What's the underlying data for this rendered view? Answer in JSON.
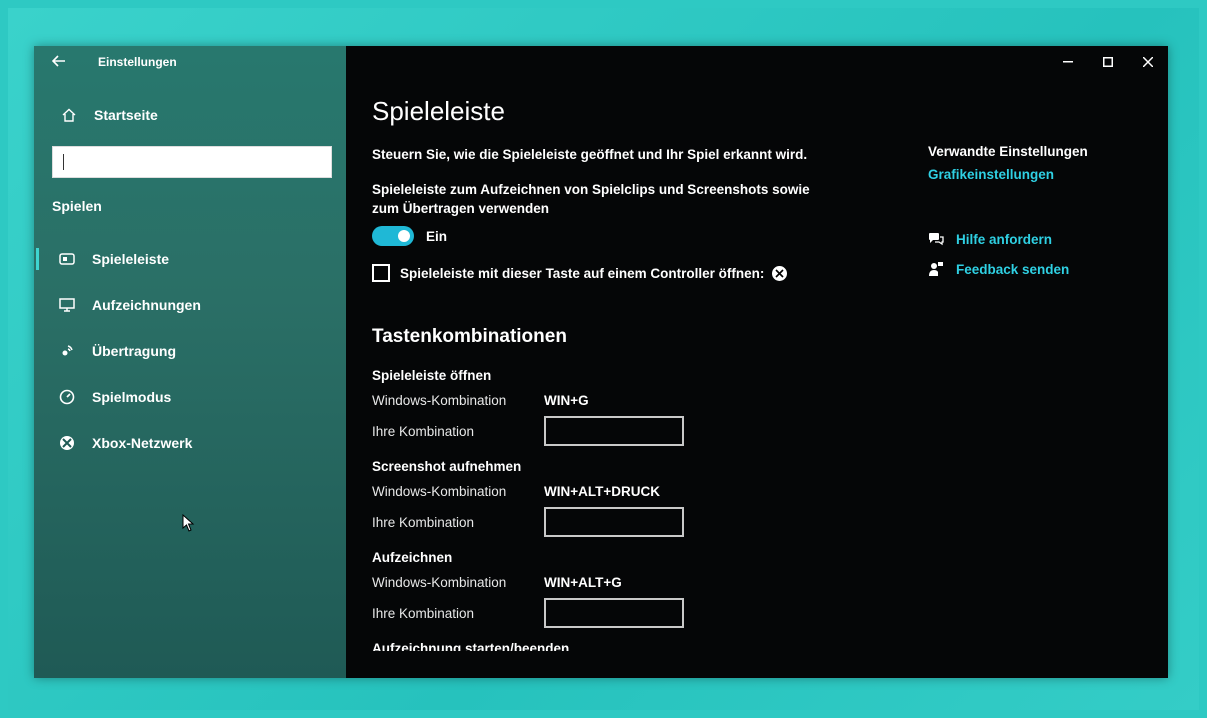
{
  "window": {
    "app_title": "Einstellungen"
  },
  "sidebar": {
    "home_label": "Startseite",
    "search_placeholder": "",
    "section_label": "Spielen",
    "items": [
      {
        "label": "Spieleleiste",
        "icon": "gamebar-icon",
        "active": true
      },
      {
        "label": "Aufzeichnungen",
        "icon": "captures-icon",
        "active": false
      },
      {
        "label": "Übertragung",
        "icon": "broadcast-icon",
        "active": false
      },
      {
        "label": "Spielmodus",
        "icon": "gamemode-icon",
        "active": false
      },
      {
        "label": "Xbox-Netzwerk",
        "icon": "xbox-icon",
        "active": false
      }
    ]
  },
  "main": {
    "title": "Spieleleiste",
    "description": "Steuern Sie, wie die Spieleleiste geöffnet und Ihr Spiel erkannt wird.",
    "toggle": {
      "label": "Spieleleiste zum Aufzeichnen von Spielclips und Screenshots sowie zum Übertragen verwenden",
      "state": "Ein",
      "on": true
    },
    "controller_checkbox": {
      "label": "Spieleleiste mit dieser Taste auf einem Controller öffnen:",
      "checked": false
    },
    "shortcuts_title": "Tastenkombinationen",
    "shortcuts": [
      {
        "heading": "Spieleleiste öffnen",
        "windows_label": "Windows-Kombination",
        "windows_value": "WIN+G",
        "custom_label": "Ihre Kombination",
        "custom_value": ""
      },
      {
        "heading": "Screenshot aufnehmen",
        "windows_label": "Windows-Kombination",
        "windows_value": "WIN+ALT+DRUCK",
        "custom_label": "Ihre Kombination",
        "custom_value": ""
      },
      {
        "heading": "Aufzeichnen",
        "windows_label": "Windows-Kombination",
        "windows_value": "WIN+ALT+G",
        "custom_label": "Ihre Kombination",
        "custom_value": ""
      }
    ],
    "cut_off_heading": "Aufzeichnung starten/beenden"
  },
  "related": {
    "heading": "Verwandte Einstellungen",
    "graphics_link": "Grafikeinstellungen",
    "help_link": "Hilfe anfordern",
    "feedback_link": "Feedback senden"
  },
  "colors": {
    "accent": "#1fb8d6",
    "link": "#2fd0e3",
    "sidebar": "#28786e",
    "main_bg": "#050607",
    "desktop": "#2ec9c3"
  }
}
